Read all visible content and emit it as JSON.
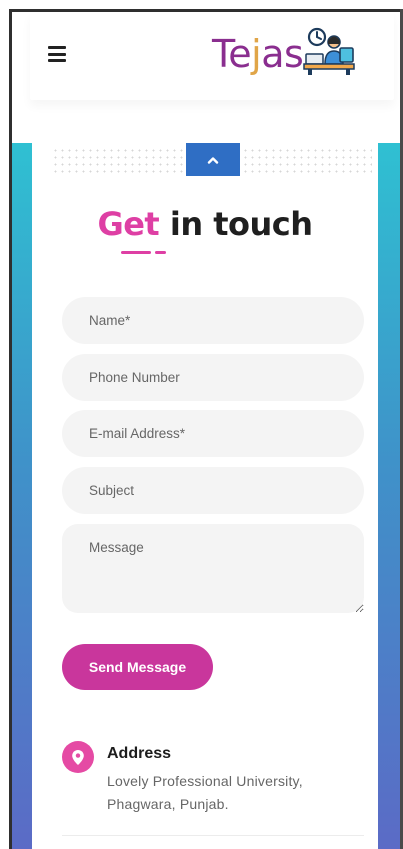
{
  "header": {
    "logo_text_before": "Te",
    "logo_text_j": "j",
    "logo_text_after": "as"
  },
  "form": {
    "title_accent": "Get",
    "title_rest": " in touch",
    "name_placeholder": "Name*",
    "phone_placeholder": "Phone Number",
    "email_placeholder": "E-mail Address*",
    "subject_placeholder": "Subject",
    "message_placeholder": "Message",
    "send_label": "Send Message"
  },
  "address": {
    "title": "Address",
    "line1": "Lovely Professional University,",
    "line2": "Phagwara, Punjab."
  },
  "icons": {
    "menu": "hamburger-menu-icon",
    "logo": "person-at-desk-icon",
    "scroll": "chevron-up-icon",
    "address": "location-pin-icon"
  },
  "colors": {
    "accent": "#de3fa4",
    "button": "#c9369c",
    "logo_purple": "#8a2e8f",
    "logo_orange": "#e0a548",
    "scroll_button": "#2f6ec4",
    "gradient_top": "#2fc0d2",
    "gradient_bottom": "#5b6bc6"
  }
}
